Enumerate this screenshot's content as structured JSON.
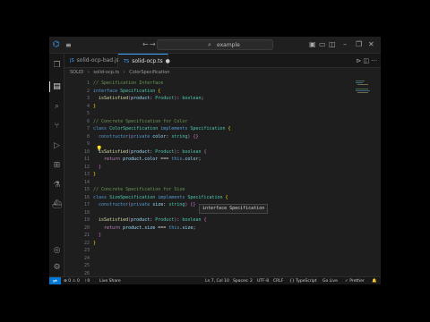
{
  "titlebar": {
    "logo_icon": "vscode-logo-icon",
    "menu_icon": "hamburger-icon",
    "nav_back": "←",
    "nav_forward": "→",
    "search_text": "example",
    "window_buttons": [
      "–",
      "❐",
      "✕"
    ]
  },
  "tabs": [
    {
      "label": "solid-ocp-bad.js",
      "active": false
    },
    {
      "label": "solid-ocp.ts",
      "active": true,
      "modified": true
    }
  ],
  "breadcrumb": [
    "SOLID",
    "›",
    "solid-ocp.ts",
    "›",
    "ColorSpecification"
  ],
  "editor": {
    "line_numbers": [
      "1",
      "2",
      "3",
      "4",
      "5",
      "6",
      "7",
      "8",
      "9",
      "10",
      "11",
      "12",
      "13",
      "14",
      "15",
      "16",
      "17",
      "18",
      "19",
      "20",
      "21",
      "22",
      "23",
      "24",
      "25",
      "26",
      "27"
    ],
    "lines": [
      [
        {
          "t": "// Specification Interface",
          "c": "c-cm"
        }
      ],
      [
        {
          "t": "interface ",
          "c": "c-kw"
        },
        {
          "t": "Specification ",
          "c": "c-ty"
        },
        {
          "t": "{",
          "c": "c-br"
        }
      ],
      [
        {
          "t": "  isSatisfied",
          "c": "c-fn"
        },
        {
          "t": "(",
          "c": "c-br2"
        },
        {
          "t": "product",
          "c": "c-vr"
        },
        {
          "t": ": ",
          "c": ""
        },
        {
          "t": "Product",
          "c": "c-ty"
        },
        {
          "t": ")",
          "c": "c-br2"
        },
        {
          "t": ": ",
          "c": ""
        },
        {
          "t": "boolean",
          "c": "c-ty"
        },
        {
          "t": ";",
          "c": ""
        }
      ],
      [
        {
          "t": "}",
          "c": "c-br"
        }
      ],
      [
        {
          "t": "",
          "c": ""
        }
      ],
      [
        {
          "t": "// Concrete Specification for Color",
          "c": "c-cm"
        }
      ],
      [
        {
          "t": "class ",
          "c": "c-kw"
        },
        {
          "t": "ColorSpecification ",
          "c": "c-ty"
        },
        {
          "t": "implements ",
          "c": "c-kw"
        },
        {
          "t": "Specification ",
          "c": "c-ty"
        },
        {
          "t": "{",
          "c": "c-br"
        }
      ],
      [
        {
          "t": "  constructor",
          "c": "c-kw"
        },
        {
          "t": "(",
          "c": "c-br2"
        },
        {
          "t": "private ",
          "c": "c-kw"
        },
        {
          "t": "color",
          "c": "c-vr"
        },
        {
          "t": ": ",
          "c": ""
        },
        {
          "t": "string",
          "c": "c-ty"
        },
        {
          "t": ") ",
          "c": "c-br2"
        },
        {
          "t": "{}",
          "c": "c-br2"
        }
      ],
      [
        {
          "t": "",
          "c": ""
        }
      ],
      [
        {
          "t": "  isSatisfied",
          "c": "c-fn"
        },
        {
          "t": "(",
          "c": "c-br2"
        },
        {
          "t": "product",
          "c": "c-vr"
        },
        {
          "t": ": ",
          "c": ""
        },
        {
          "t": "Product",
          "c": "c-ty"
        },
        {
          "t": ")",
          "c": "c-br2"
        },
        {
          "t": ": ",
          "c": ""
        },
        {
          "t": "boolean ",
          "c": "c-ty"
        },
        {
          "t": "{",
          "c": "c-br2"
        }
      ],
      [
        {
          "t": "    return ",
          "c": "c-kw2"
        },
        {
          "t": "product",
          "c": "c-vr"
        },
        {
          "t": ".",
          "c": ""
        },
        {
          "t": "color",
          "c": "c-vr"
        },
        {
          "t": " === ",
          "c": ""
        },
        {
          "t": "this",
          "c": "c-kw"
        },
        {
          "t": ".",
          "c": ""
        },
        {
          "t": "color",
          "c": "c-vr"
        },
        {
          "t": ";",
          "c": ""
        }
      ],
      [
        {
          "t": "  }",
          "c": "c-br2"
        }
      ],
      [
        {
          "t": "}",
          "c": "c-br"
        }
      ],
      [
        {
          "t": "",
          "c": ""
        }
      ],
      [
        {
          "t": "// Concrete Specification for Size",
          "c": "c-cm"
        }
      ],
      [
        {
          "t": "class ",
          "c": "c-kw"
        },
        {
          "t": "SizeSpecification ",
          "c": "c-ty"
        },
        {
          "t": "implements ",
          "c": "c-kw"
        },
        {
          "t": "Specification ",
          "c": "c-ty"
        },
        {
          "t": "{",
          "c": "c-br"
        }
      ],
      [
        {
          "t": "  constructor",
          "c": "c-kw"
        },
        {
          "t": "(",
          "c": "c-br2"
        },
        {
          "t": "private ",
          "c": "c-kw"
        },
        {
          "t": "size",
          "c": "c-vr"
        },
        {
          "t": ": ",
          "c": ""
        },
        {
          "t": "string",
          "c": "c-ty"
        },
        {
          "t": ") ",
          "c": "c-br2"
        },
        {
          "t": "{}",
          "c": "c-br2"
        }
      ],
      [
        {
          "t": "",
          "c": ""
        }
      ],
      [
        {
          "t": "  isSatisfied",
          "c": "c-fn"
        },
        {
          "t": "(",
          "c": "c-br2"
        },
        {
          "t": "product",
          "c": "c-vr"
        },
        {
          "t": ": ",
          "c": ""
        },
        {
          "t": "Product",
          "c": "c-ty"
        },
        {
          "t": ")",
          "c": "c-br2"
        },
        {
          "t": ": ",
          "c": ""
        },
        {
          "t": "boolean ",
          "c": "c-ty"
        },
        {
          "t": "{",
          "c": "c-br2"
        }
      ],
      [
        {
          "t": "    return ",
          "c": "c-kw2"
        },
        {
          "t": "product",
          "c": "c-vr"
        },
        {
          "t": ".",
          "c": ""
        },
        {
          "t": "size",
          "c": "c-vr"
        },
        {
          "t": " === ",
          "c": ""
        },
        {
          "t": "this",
          "c": "c-kw"
        },
        {
          "t": ".",
          "c": ""
        },
        {
          "t": "size",
          "c": "c-vr"
        },
        {
          "t": ";",
          "c": ""
        }
      ],
      [
        {
          "t": "  }",
          "c": "c-br2"
        }
      ],
      [
        {
          "t": "}",
          "c": "c-br"
        }
      ]
    ],
    "hover_hint": "interface Specification"
  },
  "statusbar": {
    "remote_icon": "remote-icon",
    "problems": "⊗ 0  ⚠ 0",
    "ports": "⦚ 0",
    "live_share": "Live Share",
    "cursor": "Ln 7, Col 10",
    "spaces": "Spaces: 2",
    "encoding": "UTF-8",
    "eol": "CRLF",
    "language": "{} TypeScript",
    "go_live": "Go Live",
    "prettier": "✓ Prettier",
    "bell_icon": "bell-icon"
  },
  "colors": {
    "accent": "#0078d4",
    "editor_bg": "#1e1e1e"
  }
}
